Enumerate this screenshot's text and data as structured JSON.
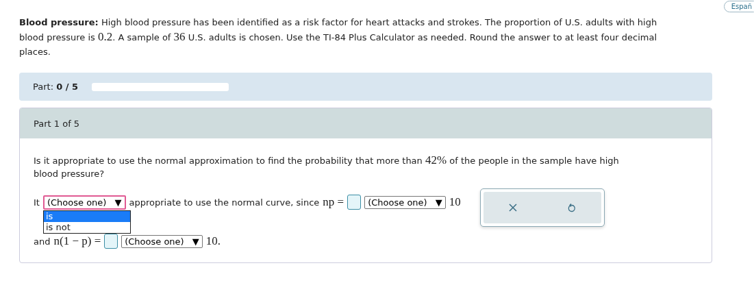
{
  "language_button": "Españ",
  "problem": [
    {
      "kind": "text",
      "text": "**Blood pressure:** High blood pressure has been identified as a risk factor for heart attacks and strokes. The proportion of U.S. adults with high blood pressure is "
    },
    {
      "kind": "math",
      "text": "0.2"
    },
    {
      "kind": "text",
      "text": ". A sample of "
    },
    {
      "kind": "math",
      "text": "36"
    },
    {
      "kind": "text",
      "text": " U.S. adults is chosen. Use the TI-84 Plus Calculator as needed. Round the answer to at least four decimal places."
    }
  ],
  "progress": {
    "label": "Part:",
    "value": "0 / 5",
    "level": 0
  },
  "part_header": "Part 1 of 5",
  "question": [
    {
      "kind": "text",
      "text": "Is it appropriate to use the normal approximation to find the probability that more than "
    },
    {
      "kind": "math",
      "text": "42%"
    },
    {
      "kind": "text",
      "text": " of the people in the sample have high blood pressure?"
    }
  ],
  "answer_lines": [
    {
      "items": [
        {
          "kind": "text",
          "text": "It"
        },
        {
          "kind": "select",
          "label": "(Choose one)",
          "arrow": "▼",
          "open": true,
          "options": [
            {
              "label": "is",
              "selected": true
            },
            {
              "label": "is not",
              "selected": false
            }
          ]
        },
        {
          "kind": "text",
          "text": "appropriate to use the normal curve, since"
        },
        {
          "kind": "math",
          "text": "np ="
        },
        {
          "kind": "input"
        },
        {
          "kind": "select",
          "label": "(Choose one)",
          "arrow": "▼",
          "open": false
        },
        {
          "kind": "math",
          "text": "10"
        }
      ]
    },
    {
      "items": [
        {
          "kind": "text",
          "text": "and"
        },
        {
          "kind": "math",
          "text": "n(1 − p) ="
        },
        {
          "kind": "input"
        },
        {
          "kind": "select",
          "label": "(Choose one)",
          "arrow": "▼",
          "open": false
        },
        {
          "kind": "math",
          "text": "10."
        }
      ]
    }
  ]
}
